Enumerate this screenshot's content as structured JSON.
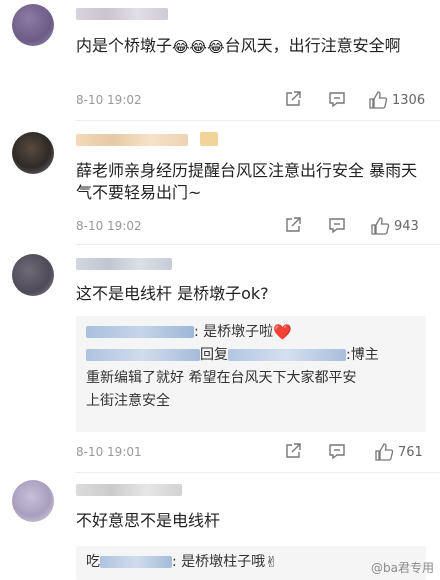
{
  "comments": [
    {
      "text": "内是个桥墩子",
      "text_after": "台风天，出行注意安全啊",
      "emoji": "😂",
      "time": "8-10 19:02",
      "likes": "1306"
    },
    {
      "text": "薛老师亲身经历提醒台风区注意出行安全 暴雨天气不要轻易出门~",
      "time": "8-10 19:02",
      "likes": "943"
    },
    {
      "text": "这不是电线杆 是桥墩子ok?",
      "time": "8-10 19:01",
      "likes": "761",
      "replies": [
        {
          "text": ": 是桥墩子啦",
          "emoji": "❤️"
        },
        {
          "prefix": "回复",
          "text": ":博主"
        },
        {
          "text": "重新编辑了就好 希望在台风天下大家都平安"
        },
        {
          "text": "上街注意安全"
        }
      ]
    },
    {
      "text": "不好意思不是电线杆",
      "replies": [
        {
          "prefix": "吃",
          "text": ": 是桥墩柱子哦",
          "emoji": "✌"
        }
      ]
    }
  ],
  "watermark": "@ba君专用",
  "icons": [
    "share-icon",
    "comment-icon",
    "like-icon"
  ]
}
